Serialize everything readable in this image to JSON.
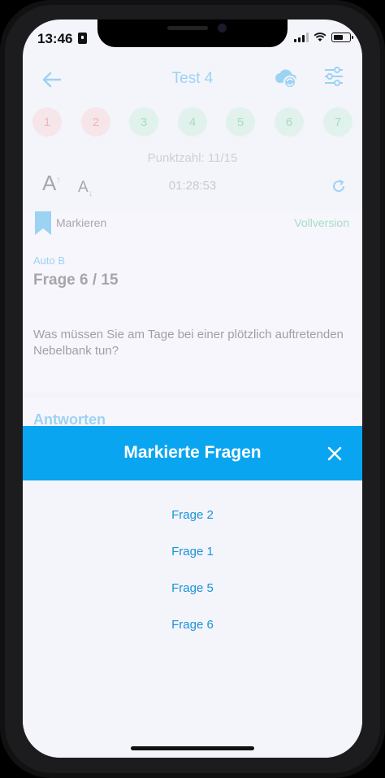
{
  "status_bar": {
    "time": "13:46"
  },
  "header": {
    "title": "Test 4"
  },
  "question_nav": [
    {
      "label": "1",
      "state": "wrong"
    },
    {
      "label": "2",
      "state": "wrong"
    },
    {
      "label": "3",
      "state": "right"
    },
    {
      "label": "4",
      "state": "right"
    },
    {
      "label": "5",
      "state": "right"
    },
    {
      "label": "6",
      "state": "right"
    },
    {
      "label": "7",
      "state": "right"
    }
  ],
  "score": "Punktzahl: 11/15",
  "font_controls": {
    "increase": "A",
    "decrease": "A"
  },
  "timer": "01:28:53",
  "card": {
    "mark_label": "Markieren",
    "full_version": "Vollversion",
    "category": "Auto B",
    "question_title": "Frage 6 / 15",
    "question_text": "Was müssen Sie am Tage bei einer plötzlich auftretenden Nebelbank tun?"
  },
  "answers": {
    "title": "Antworten"
  },
  "modal": {
    "title": "Markierte Fragen",
    "items": [
      "Frage 2",
      "Frage 1",
      "Frage 5",
      "Frage 6"
    ]
  },
  "colors": {
    "accent": "#0aa5f0",
    "wrong": "#e55d5d",
    "right": "#35b96f"
  }
}
